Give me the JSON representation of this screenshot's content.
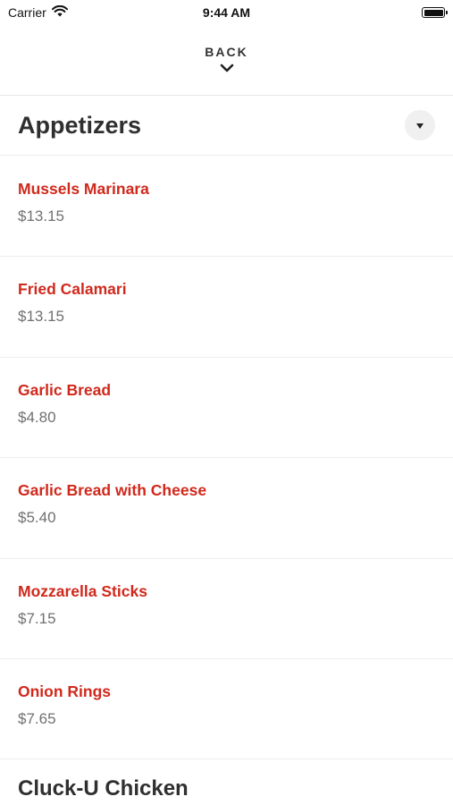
{
  "status_bar": {
    "carrier": "Carrier",
    "time": "9:44 AM"
  },
  "nav": {
    "back_label": "BACK"
  },
  "section": {
    "title": "Appetizers"
  },
  "items": [
    {
      "name": "Mussels Marinara",
      "price": "$13.15"
    },
    {
      "name": "Fried Calamari",
      "price": "$13.15"
    },
    {
      "name": "Garlic Bread",
      "price": "$4.80"
    },
    {
      "name": "Garlic Bread with Cheese",
      "price": "$5.40"
    },
    {
      "name": "Mozzarella Sticks",
      "price": "$7.15"
    },
    {
      "name": "Onion Rings",
      "price": "$7.65"
    }
  ],
  "next_section": {
    "title": "Cluck-U Chicken"
  },
  "colors": {
    "item_name": "#d0291c",
    "price": "#707070",
    "title": "#2f2f2f"
  },
  "icons": {
    "wifi": "wifi-icon",
    "battery": "battery-icon",
    "back": "chevron-down-icon",
    "toggle": "triangle-down-icon"
  }
}
